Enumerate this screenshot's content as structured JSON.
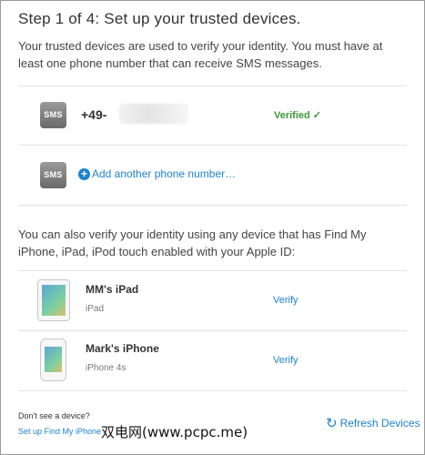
{
  "header": {
    "title": "Step 1 of 4: Set up your trusted devices.",
    "intro": "Your trusted devices are used to verify your identity. You must have at least one phone number that can receive SMS messages."
  },
  "phone": {
    "badge": "SMS",
    "number_prefix": "+49-",
    "status": "Verified ✓",
    "status_color": "#3a9a3a"
  },
  "add_phone": {
    "badge": "SMS",
    "icon": "plus-circle-icon",
    "label": "Add another phone number…"
  },
  "find_my": {
    "text": "You can also verify your identity using any device that has Find My iPhone, iPad, iPod touch enabled with your Apple ID:"
  },
  "devices": [
    {
      "name": "MM's iPad",
      "type": "iPad",
      "action": "Verify"
    },
    {
      "name": "Mark's iPhone",
      "type": "iPhone 4s",
      "action": "Verify"
    }
  ],
  "footer": {
    "dont_see": "Don't see a device?",
    "setup_link": "Set up Find My iPhone",
    "refresh": "Refresh Devices",
    "refresh_icon": "refresh-icon",
    "link_color": "#1e82d0"
  },
  "watermark": "双电网(www.pcpc.me)"
}
